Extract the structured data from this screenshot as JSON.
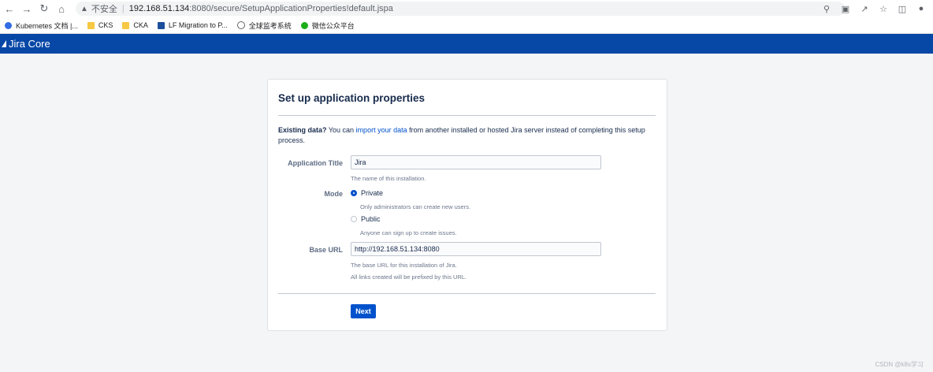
{
  "browser": {
    "insecure_label": "不安全",
    "url_host": "192.168.51.134",
    "url_path": ":8080/secure/SetupApplicationProperties!default.jspa"
  },
  "bookmarks": [
    {
      "label": "Kubernetes 文档 |...",
      "icon": "kubernetes-icon"
    },
    {
      "label": "CKS",
      "icon": "folder-icon"
    },
    {
      "label": "CKA",
      "icon": "folder-icon"
    },
    {
      "label": "LF Migration to P...",
      "icon": "lf-icon"
    },
    {
      "label": "全球监考系统",
      "icon": "globe-icon"
    },
    {
      "label": "微信公众平台",
      "icon": "wechat-icon"
    }
  ],
  "header": {
    "product_name": "Jira Core"
  },
  "setup": {
    "title": "Set up application properties",
    "intro_bold": "Existing data?",
    "intro_pre": " You can ",
    "intro_link": "import your data",
    "intro_post": " from another installed or hosted Jira server instead of completing this setup process.",
    "app_title_label": "Application Title",
    "app_title_value": "Jira",
    "app_title_hint": "The name of this installation.",
    "mode_label": "Mode",
    "mode_private_label": "Private",
    "mode_private_hint": "Only administrators can create new users.",
    "mode_public_label": "Public",
    "mode_public_hint": "Anyone can sign up to create issues.",
    "selected_mode": "Private",
    "base_url_label": "Base URL",
    "base_url_value": "http://192.168.51.134:8080",
    "base_url_hint1": "The base URL for this installation of Jira.",
    "base_url_hint2": "All links created will be prefixed by this URL.",
    "next_label": "Next"
  },
  "watermark": "CSDN @k8s学习"
}
